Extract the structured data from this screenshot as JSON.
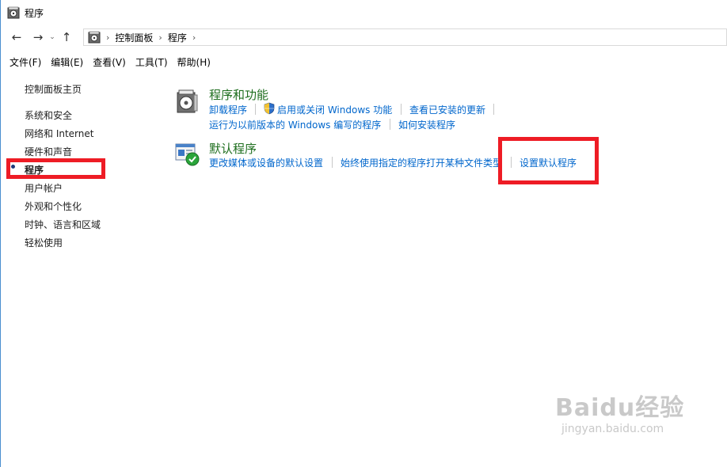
{
  "window": {
    "title": "程序"
  },
  "address": {
    "crumbs": [
      "控制面板",
      "程序"
    ]
  },
  "menubar": {
    "items": [
      "文件(F)",
      "编辑(E)",
      "查看(V)",
      "工具(T)",
      "帮助(H)"
    ]
  },
  "sidebar": {
    "items": [
      {
        "label": "控制面板主页"
      },
      {
        "label": "系统和安全"
      },
      {
        "label": "网络和 Internet"
      },
      {
        "label": "硬件和声音"
      },
      {
        "label": "程序",
        "active": true
      },
      {
        "label": "用户帐户"
      },
      {
        "label": "外观和个性化"
      },
      {
        "label": "时钟、语言和区域"
      },
      {
        "label": "轻松使用"
      }
    ]
  },
  "categories": [
    {
      "title": "程序和功能",
      "links": [
        "卸载程序",
        "启用或关闭 Windows 功能",
        "查看已安装的更新",
        "运行为以前版本的 Windows 编写的程序",
        "如何安装程序"
      ]
    },
    {
      "title": "默认程序",
      "links": [
        "更改媒体或设备的默认设置",
        "始终使用指定的程序打开某种文件类型",
        "设置默认程序"
      ]
    }
  ],
  "colors": {
    "link": "#0066cc",
    "category_title": "#1e6e1e",
    "highlight": "#ee1c25"
  },
  "watermark": {
    "main": "Baidu经验",
    "sub": "jingyan.baidu.com"
  }
}
